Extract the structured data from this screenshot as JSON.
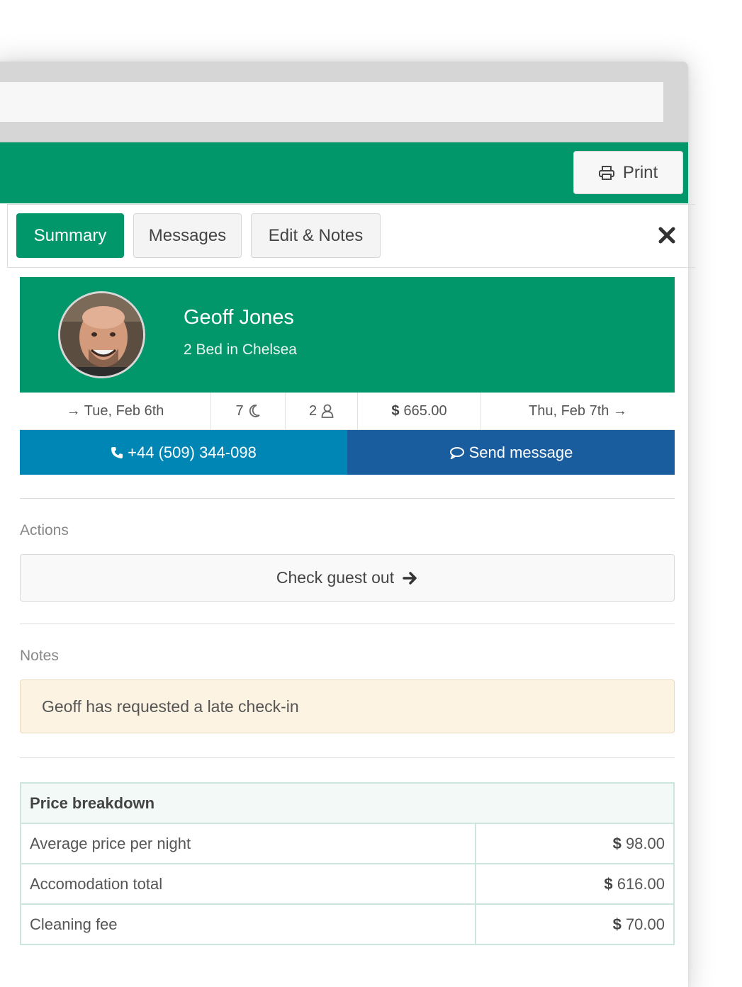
{
  "toolbar": {
    "print_label": "Print"
  },
  "tabs": [
    {
      "label": "Summary",
      "active": true
    },
    {
      "label": "Messages",
      "active": false
    },
    {
      "label": "Edit & Notes",
      "active": false
    }
  ],
  "guest": {
    "name": "Geoff Jones",
    "listing": "2 Bed in Chelsea"
  },
  "stats": {
    "checkin": "→ Tue, Feb 6th",
    "nights": "7",
    "guests": "2",
    "currency": "$",
    "total": "665.00",
    "checkout": "Thu, Feb 7th →"
  },
  "contact": {
    "phone": "+44 (509) 344-098",
    "message_label": "Send message"
  },
  "actions": {
    "heading": "Actions",
    "checkout_label": "Check guest out"
  },
  "notes": {
    "heading": "Notes",
    "text": "Geoff has requested a late check-in"
  },
  "price": {
    "heading": "Price breakdown",
    "rows": [
      {
        "label": "Average price per night",
        "currency": "$",
        "value": "98.00"
      },
      {
        "label": "Accomodation total",
        "currency": "$",
        "value": "616.00"
      },
      {
        "label": "Cleaning fee",
        "currency": "$",
        "value": "70.00"
      }
    ]
  },
  "colors": {
    "brand_green": "#02976b",
    "call_blue": "#0086b4",
    "message_blue": "#1a5d9e",
    "note_bg": "#fdf3e3"
  }
}
